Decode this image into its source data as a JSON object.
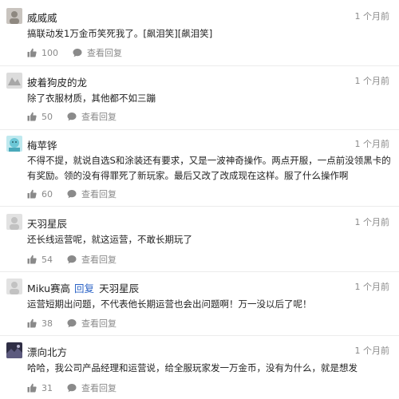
{
  "comments": [
    {
      "user": "威威威",
      "time": "1 个月前",
      "text": "搞联动发1万金币笑死我了。[飙泪笑][飙泪笑]",
      "likes": "100",
      "view_replies": "查看回复",
      "avatar_color": "#c9c4bf"
    },
    {
      "user": "披着狗皮的龙",
      "time": "1 个月前",
      "text": "除了衣服材质，其他都不如三蹦",
      "likes": "50",
      "view_replies": "查看回复",
      "avatar_color": "#d8d8d8"
    },
    {
      "user": "梅苹铧",
      "time": "1 个月前",
      "text": "不得不提，就说自选S和涂装还有要求，又是一波神奇操作。两点开服，一点前没领黑卡的有奖励。领的没有得罪死了新玩家。最后又改了改成现在这样。服了什么操作啊",
      "likes": "60",
      "view_replies": "查看回复",
      "avatar_color": "#6cc7d6"
    },
    {
      "user": "天羽星辰",
      "time": "1 个月前",
      "text": "还长线运营呢，就这运营，不敢长期玩了",
      "likes": "54",
      "view_replies": "查看回复",
      "avatar_color": "#e2e2e2"
    },
    {
      "user": "Miku赛高",
      "reply_label": "回复",
      "reply_to": "天羽星辰",
      "time": "1 个月前",
      "text": "运营短期出问题，不代表他长期运营也会出问题啊！万一没以后了呢！",
      "likes": "38",
      "view_replies": "查看回复",
      "avatar_color": "#e2e2e2"
    },
    {
      "user": "漂向北方",
      "time": "1 个月前",
      "text": "哈哈，我公司产品经理和运营说，给全服玩家发一万金币，没有为什么，就是想发",
      "likes": "31",
      "view_replies": "查看回复",
      "avatar_color": "#4b4a66"
    }
  ],
  "icons": {
    "like": "thumbs-up-icon",
    "view": "chat-bubble-icon"
  }
}
